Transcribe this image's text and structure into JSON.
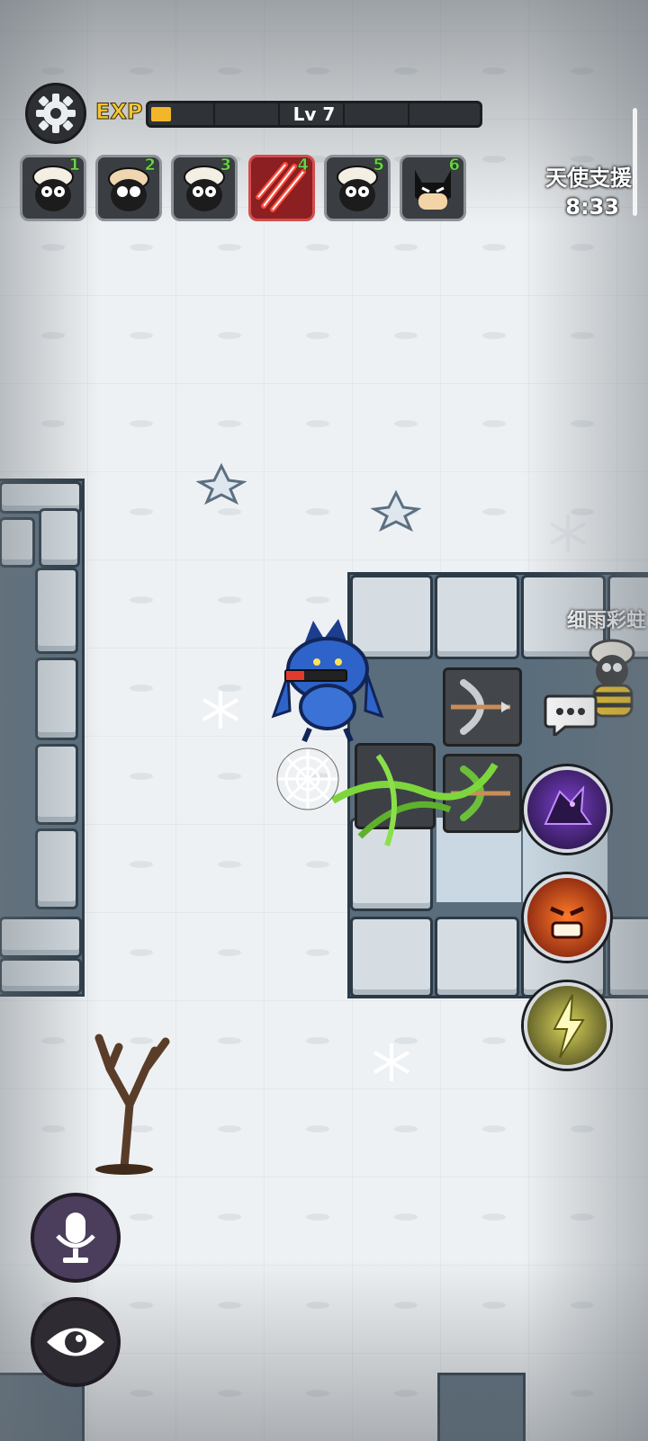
{
  "hud": {
    "exp_label": "EXP",
    "level_label": "Lv 7",
    "exp_progress": 0.06,
    "support_label": "天使支援",
    "support_timer": "8:33"
  },
  "slots": [
    {
      "num": "1",
      "icon": "sheep-face-icon",
      "active": false
    },
    {
      "num": "2",
      "icon": "masked-sheep-icon",
      "active": false
    },
    {
      "num": "3",
      "icon": "sheep-face-icon",
      "active": false
    },
    {
      "num": "4",
      "icon": "claw-slash-icon",
      "active": true
    },
    {
      "num": "5",
      "icon": "sheep-face-icon",
      "active": false
    },
    {
      "num": "6",
      "icon": "bat-mask-icon",
      "active": false
    }
  ],
  "player": {
    "name": "细雨彩蛀"
  },
  "skills": [
    {
      "icon": "shadow-wolf-skill-icon"
    },
    {
      "icon": "rage-face-skill-icon"
    },
    {
      "icon": "lightning-skill-icon"
    }
  ],
  "controls": {
    "voice": "microphone-icon",
    "view": "eye-icon"
  },
  "colors": {
    "exp_fill": "#f3b62a",
    "level_number": "#6bd14a",
    "active_slot": "#8b1f22"
  }
}
